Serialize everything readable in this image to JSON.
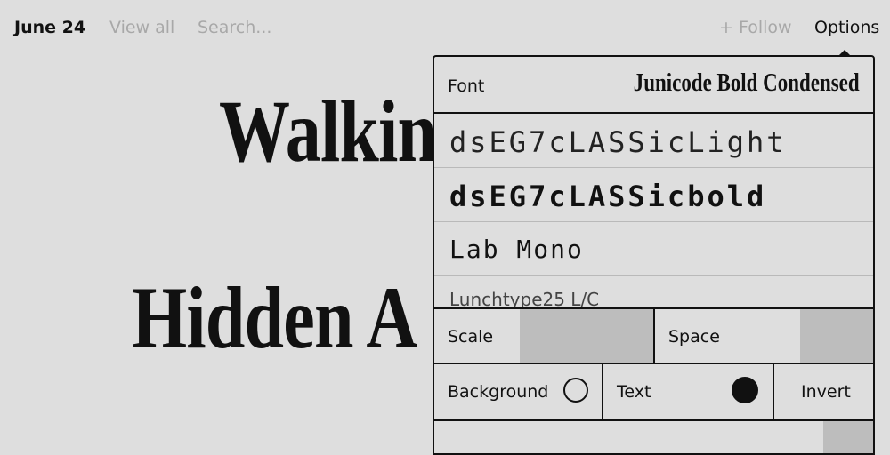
{
  "nav": {
    "date": "June 24",
    "view_all": "View all",
    "search_placeholder": "Search...",
    "follow": "+ Follow",
    "options": "Options"
  },
  "article": {
    "headline_line1": "Walkin",
    "headline_line2": "Hidden A"
  },
  "options_panel": {
    "font_label": "Font",
    "font_value": "Junicode Bold Condensed",
    "font_list": [
      "dsEG7cLASSicLight",
      "dsEG7cLASSicbold",
      "Lab Mono",
      "Lunchtype25 L/C"
    ],
    "scale_label": "Scale",
    "space_label": "Space",
    "background_label": "Background",
    "text_label": "Text",
    "invert_label": "Invert",
    "background_swatch": "#dedede",
    "text_swatch": "#111111"
  }
}
